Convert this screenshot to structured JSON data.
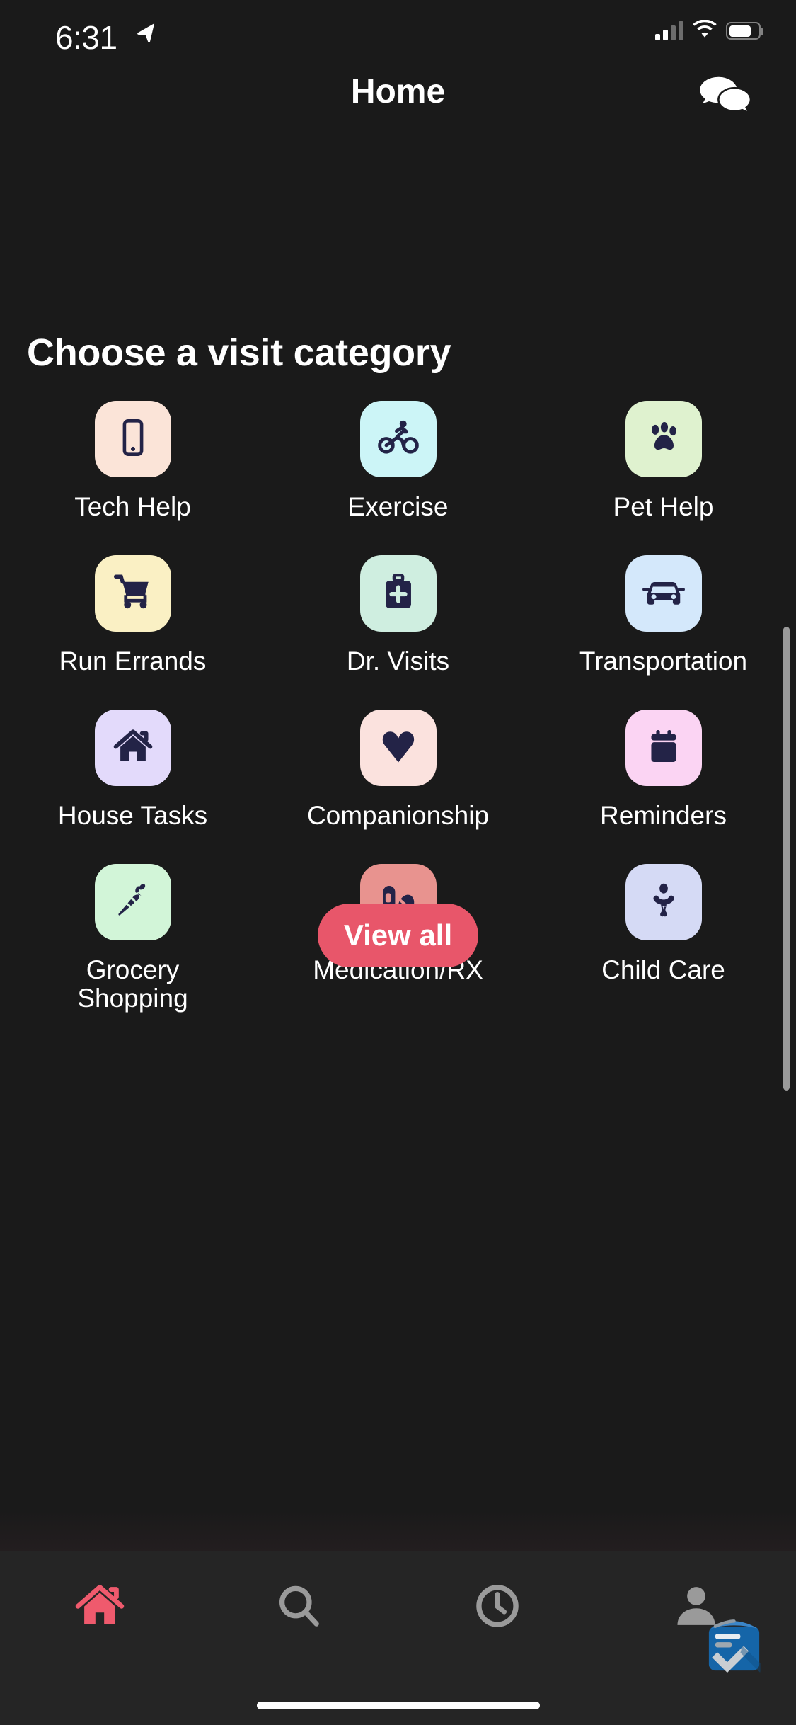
{
  "status_bar": {
    "time": "6:31",
    "location_icon": "location-arrow-icon",
    "signal_icon": "cellular-signal-icon",
    "wifi_icon": "wifi-icon",
    "battery_icon": "battery-icon",
    "battery_level_percent": 68
  },
  "header": {
    "title": "Home",
    "chat_icon": "chat-bubbles-icon"
  },
  "main": {
    "section_title": "Choose a visit category",
    "categories": [
      {
        "label": "Tech Help",
        "icon": "smartphone-icon",
        "tile_color": "#fbe4d8",
        "icon_color": "#232347"
      },
      {
        "label": "Exercise",
        "icon": "cyclist-icon",
        "tile_color": "#ccf5f7",
        "icon_color": "#232347"
      },
      {
        "label": "Pet Help",
        "icon": "paw-print-icon",
        "tile_color": "#dff2cf",
        "icon_color": "#232347"
      },
      {
        "label": "Run Errands",
        "icon": "shopping-cart-icon",
        "tile_color": "#faf0c4",
        "icon_color": "#232347"
      },
      {
        "label": "Dr. Visits",
        "icon": "medical-bag-icon",
        "tile_color": "#cfeee0",
        "icon_color": "#232347"
      },
      {
        "label": "Transportation",
        "icon": "car-icon",
        "tile_color": "#d4e8fb",
        "icon_color": "#232347"
      },
      {
        "label": "House Tasks",
        "icon": "house-icon",
        "tile_color": "#e3dafb",
        "icon_color": "#232347"
      },
      {
        "label": "Companionship",
        "icon": "heart-icon",
        "tile_color": "#fbe2de",
        "icon_color": "#232347"
      },
      {
        "label": "Reminders",
        "icon": "calendar-icon",
        "tile_color": "#fbd4f3",
        "icon_color": "#232347"
      },
      {
        "label": "Grocery\nShopping",
        "icon": "carrot-icon",
        "tile_color": "#d2f5d8",
        "icon_color": "#232347"
      },
      {
        "label": "Medication/RX",
        "icon": "pills-icon",
        "tile_color": "#e8938f",
        "icon_color": "#232347"
      },
      {
        "label": "Child Care",
        "icon": "baby-icon",
        "tile_color": "#d5daf5",
        "icon_color": "#232347"
      }
    ],
    "view_all_label": "View all",
    "view_all_color": "#e8566a"
  },
  "tab_bar": {
    "tabs": [
      {
        "name": "home",
        "icon": "home-icon",
        "active": true
      },
      {
        "name": "search",
        "icon": "search-icon",
        "active": false
      },
      {
        "name": "history",
        "icon": "clock-icon",
        "active": false
      },
      {
        "name": "profile",
        "icon": "person-icon",
        "active": false
      }
    ],
    "active_color": "#ef5a6d",
    "inactive_color": "#9a9a9a",
    "overlay_icon": "clipboard-check-icon",
    "overlay_color": "#1565a8"
  }
}
